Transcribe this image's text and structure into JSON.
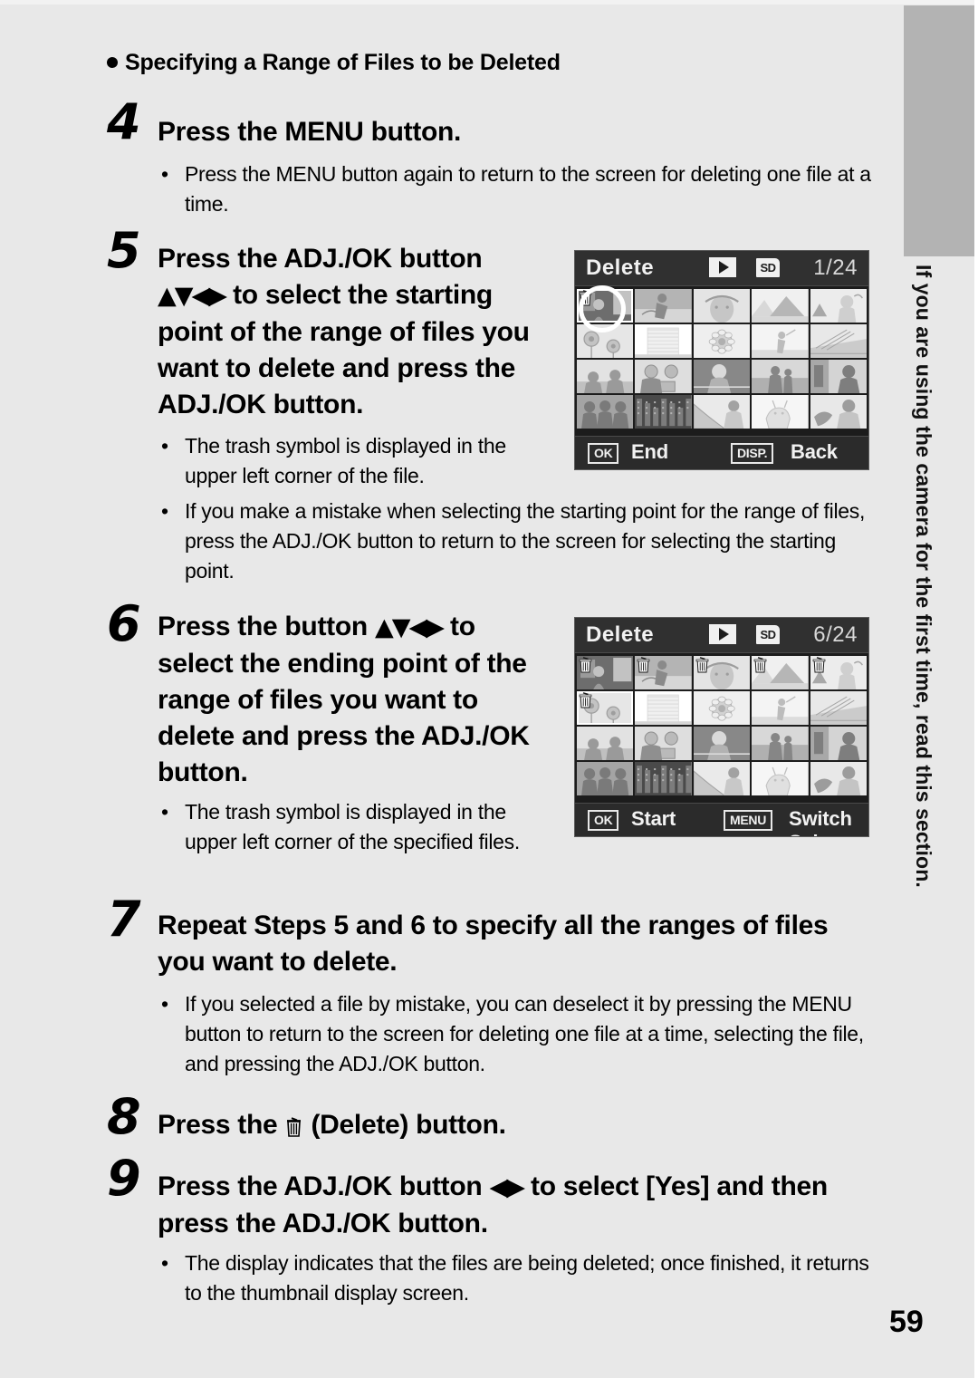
{
  "page": {
    "number": "59",
    "background_color": "#e8e8e8",
    "tab_color": "#b3b3b3"
  },
  "side_tab": {
    "text": "If you are using the camera for the first time, read this section."
  },
  "section_heading": {
    "bullet_icon": "filled-circle-icon",
    "text": "Specifying a Range of Files to be Deleted"
  },
  "steps": [
    {
      "number": "4",
      "title": "Press the MENU button.",
      "bullets": [
        "Press the MENU button again to return to the screen for deleting one file at a time."
      ]
    },
    {
      "number": "5",
      "title_part1": "Press the ADJ./OK button",
      "title_arrows": "▲▼◀▶",
      "title_part2": "to select the starting point of the range of files you want to delete and press the ADJ./OK button.",
      "bullets": [
        "The trash symbol is displayed in the upper left corner of the file.",
        "If you make a mistake when selecting the starting point for the range of files, press the ADJ./OK button to return to the screen for selecting the starting point."
      ]
    },
    {
      "number": "6",
      "title_part1": "Press the button",
      "title_arrows": "▲▼◀▶",
      "title_part2": "to select the ending point of the range of files you want to delete and press the ADJ./OK button.",
      "bullets": [
        "The trash symbol is displayed in the upper left corner of the specified files."
      ]
    },
    {
      "number": "7",
      "title": "Repeat Steps 5 and 6 to specify all the ranges of files you want to delete.",
      "bullets": [
        "If you selected a file by mistake, you can deselect it by pressing the MENU button to return to the screen for deleting one file at a time, selecting the file, and pressing the ADJ./OK button."
      ]
    },
    {
      "number": "8",
      "title_part1": "Press the",
      "title_icon": "trash-icon",
      "title_part2": "(Delete) button.",
      "bullets": []
    },
    {
      "number": "9",
      "title_part1": "Press the ADJ./OK button",
      "title_arrows": "◀▶",
      "title_part2": "to select [Yes] and then press the ADJ./OK button.",
      "bullets": [
        "The display indicates that the files are being deleted; once finished, it returns to the thumbnail display screen."
      ]
    }
  ],
  "screens": [
    {
      "id": "start-point-screen",
      "title": "Delete",
      "play_icon": "play-icon",
      "sd_icon": "SD",
      "counter": "1/24",
      "footer": {
        "left_key": "OK",
        "left_label": "End",
        "right_key": "DISP.",
        "right_label": "Back"
      },
      "selected_index": 0,
      "trashed_indices": [
        0
      ],
      "highlight_circle": true,
      "thumbnail_count": 20
    },
    {
      "id": "end-point-screen",
      "title": "Delete",
      "play_icon": "play-icon",
      "sd_icon": "SD",
      "counter": "6/24",
      "footer": {
        "left_key": "OK",
        "left_label": "Start",
        "right_key": "MENU",
        "right_label": "Switch Sel"
      },
      "selected_index": 5,
      "trashed_indices": [
        0,
        1,
        2,
        3,
        4,
        5
      ],
      "highlight_circle": false,
      "thumbnail_count": 20
    }
  ]
}
